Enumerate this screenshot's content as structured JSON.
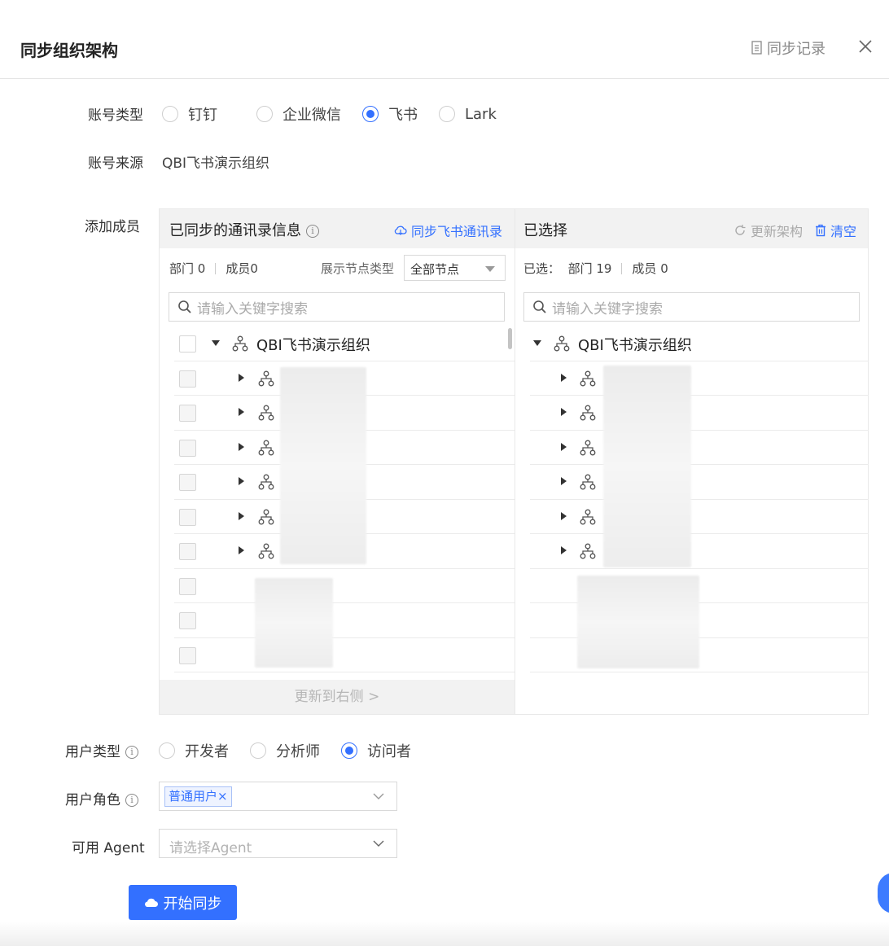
{
  "header": {
    "title": "同步组织架构",
    "sync_log": "同步记录",
    "close_icon": "close-icon"
  },
  "account_type": {
    "label": "账号类型",
    "options": [
      "钉钉",
      "企业微信",
      "飞书",
      "Lark"
    ],
    "selected": "飞书"
  },
  "account_source": {
    "label": "账号来源",
    "value": "QBI飞书演示组织"
  },
  "add_members": {
    "label": "添加成员"
  },
  "left_panel": {
    "title": "已同步的通讯录信息",
    "sync_link": "同步飞书通讯录",
    "dept_label": "部门",
    "dept_count": "0",
    "member_label": "成员0",
    "node_type_label": "展示节点类型",
    "node_type_value": "全部节点",
    "search_placeholder": "请输入关键字搜索",
    "root": "QBI飞书演示组织",
    "update_button": "更新到右侧 >"
  },
  "right_panel": {
    "title": "已选择",
    "refresh_link": "更新架构",
    "clear_link": "清空",
    "selected_label": "已选：",
    "dept_label": "部门 19",
    "member_label": "成员 0",
    "search_placeholder": "请输入关键字搜索",
    "root": "QBI飞书演示组织"
  },
  "user_type": {
    "label": "用户类型",
    "options": [
      "开发者",
      "分析师",
      "访问者"
    ],
    "selected": "访问者"
  },
  "user_role": {
    "label": "用户角色",
    "tag": "普通用户×"
  },
  "agent": {
    "label": "可用 Agent",
    "placeholder": "请选择Agent"
  },
  "start_button": "开始同步",
  "colors": {
    "accent": "#3370ff"
  }
}
